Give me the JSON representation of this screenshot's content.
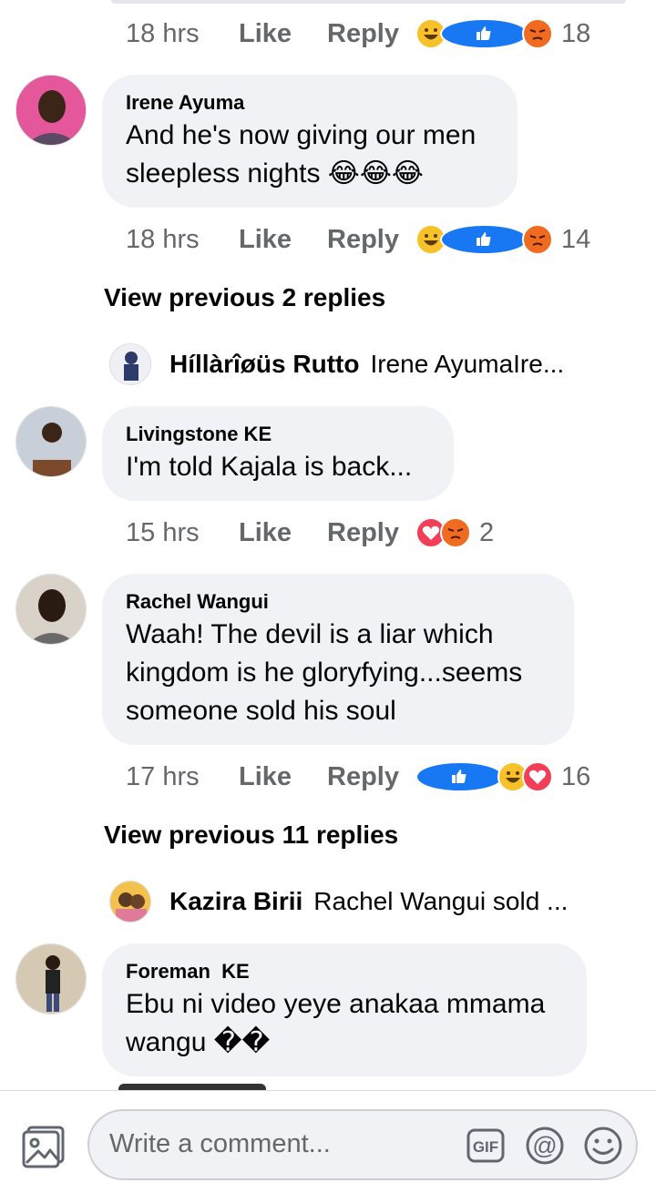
{
  "comments": [
    {
      "time": "18 hrs",
      "like": "Like",
      "reply": "Reply",
      "reactions": [
        "haha",
        "like",
        "angry"
      ],
      "count": "18"
    },
    {
      "name": "Irene Ayuma",
      "text1": "And he's now giving our men",
      "text2": "sleepless nights 😂😂😂",
      "time": "18 hrs",
      "like": "Like",
      "reply": "Reply",
      "reactions": [
        "haha",
        "like",
        "angry"
      ],
      "count": "14"
    },
    {
      "name": "Livingstone KE",
      "text1": "I'm told Kajala is back...",
      "time": "15 hrs",
      "like": "Like",
      "reply": "Reply",
      "reactions": [
        "love",
        "angry"
      ],
      "count": "2"
    },
    {
      "name": "Rachel Wangui",
      "text1": "Waah! The devil is a liar which",
      "text2": "kingdom is he gloryfying...seems",
      "text3": "someone sold his soul",
      "time": "17 hrs",
      "like": "Like",
      "reply": "Reply",
      "reactions": [
        "like",
        "haha",
        "love"
      ],
      "count": "16"
    },
    {
      "name": "Foreman  KE",
      "text1": "Ebu ni video yeye anakaa mmama",
      "text2": "wangu ��"
    }
  ],
  "view_previous": [
    "View previous 2 replies",
    "View previous 11 replies"
  ],
  "reply_previews": [
    {
      "name": "Híllàrîøüs Rutto",
      "text": "Irene AyumaIre..."
    },
    {
      "name": "Kazira Birii",
      "text": "Rachel Wangui sold ..."
    }
  ],
  "composer": {
    "placeholder": "Write a comment...",
    "gif": "GIF",
    "at": "@"
  },
  "colors": {
    "bubble": "#f0f2f5",
    "meta": "#65676b",
    "like_blue": "#1877f2",
    "haha": "#f7c12a",
    "angry": "#f06a20",
    "love": "#f33e58"
  }
}
